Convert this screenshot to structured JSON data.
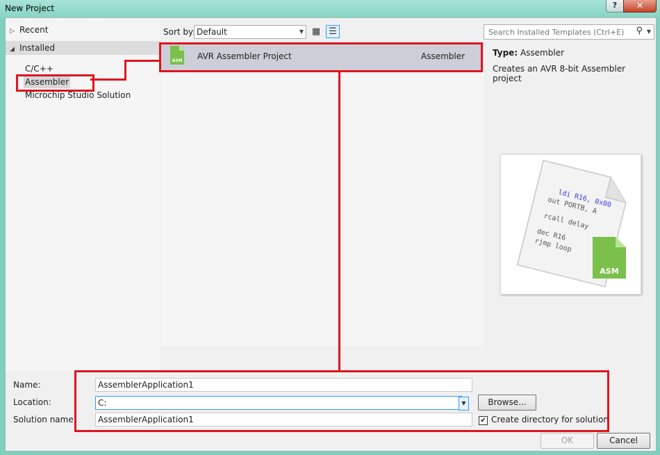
{
  "window": {
    "title": "New Project",
    "help_label": "?",
    "close_label": "✕"
  },
  "tree": {
    "recent": "Recent",
    "installed": "Installed",
    "children": [
      "C/C++",
      "Assembler",
      "Microchip Studio Solution"
    ]
  },
  "toolbar": {
    "sort_label": "Sort by:",
    "sort_value": "Default",
    "search_placeholder": "Search Installed Templates (Ctrl+E)"
  },
  "templates": [
    {
      "name": "AVR Assembler Project",
      "language": "Assembler",
      "icon_text": "ASM"
    }
  ],
  "details": {
    "type_label": "Type:",
    "type_value": "Assembler",
    "description": "Creates an AVR 8-bit Assembler project"
  },
  "preview": {
    "code_lines": [
      "ldi R16, 0x00",
      "out PORTB, A",
      "rcall delay",
      "dec R16",
      "rjmp loop"
    ],
    "badge": "ASM"
  },
  "form": {
    "name_label": "Name:",
    "name_value": "AssemblerApplication1",
    "location_label": "Location:",
    "location_value": "C:",
    "solution_label": "Solution name:",
    "solution_value": "AssemblerApplication1",
    "browse_label": "Browse...",
    "create_dir_label": "Create directory for solution",
    "create_dir_checked": true
  },
  "buttons": {
    "ok": "OK",
    "cancel": "Cancel"
  },
  "colors": {
    "annotation": "#e0141e",
    "asm_green": "#7bc04a",
    "selection": "#ccced8"
  }
}
